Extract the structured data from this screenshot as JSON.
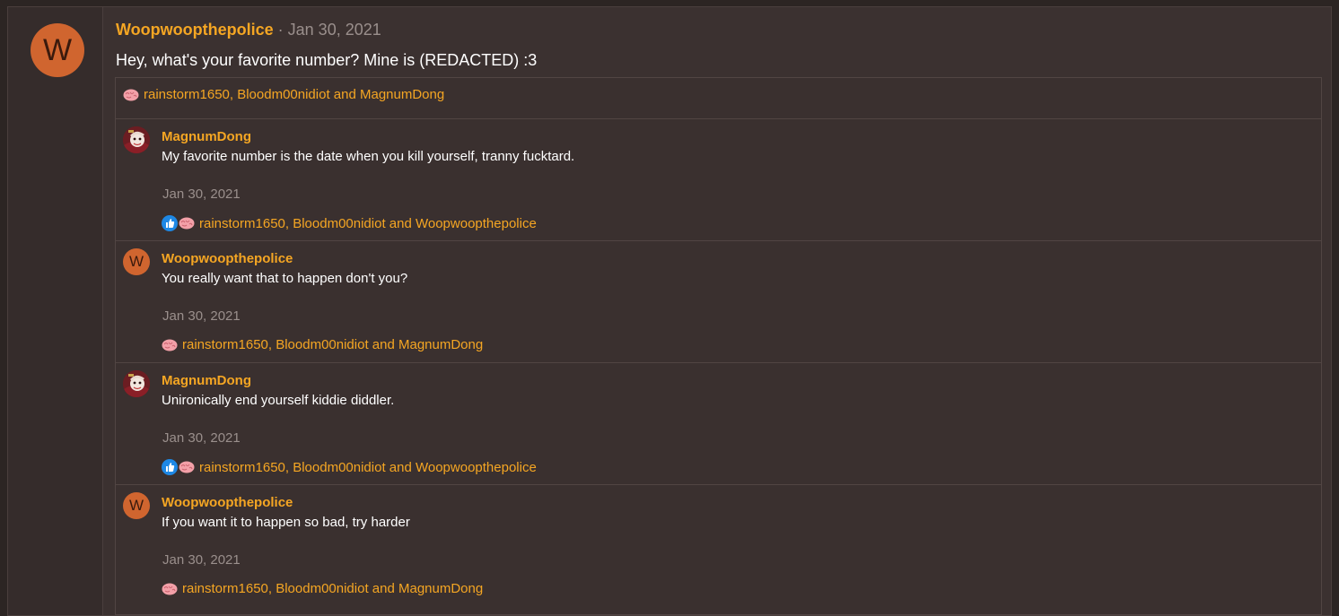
{
  "post": {
    "avatar_letter": "W",
    "author": "Woopwoopthepolice",
    "separator": " · ",
    "date": "Jan 30, 2021",
    "body": "Hey, what's your favorite number? Mine is (REDACTED) :3",
    "reactions": "rainstorm1650, Bloodm00nidiot and MagnumDong"
  },
  "replies": [
    {
      "author": "MagnumDong",
      "text": "My favorite number is the date when you kill yourself, tranny fucktard.",
      "date": "Jan 30, 2021",
      "reactions": "rainstorm1650, Bloodm00nidiot and Woopwoopthepolice"
    },
    {
      "author": "Woopwoopthepolice",
      "avatar_letter": "W",
      "text": "You really want that to happen don't you?",
      "date": "Jan 30, 2021",
      "reactions": "rainstorm1650, Bloodm00nidiot and MagnumDong"
    },
    {
      "author": "MagnumDong",
      "text": "Unironically end yourself kiddie diddler.",
      "date": "Jan 30, 2021",
      "reactions": "rainstorm1650, Bloodm00nidiot and Woopwoopthepolice"
    },
    {
      "author": "Woopwoopthepolice",
      "avatar_letter": "W",
      "text": "If you want it to happen so bad, try harder",
      "date": "Jan 30, 2021",
      "reactions": "rainstorm1650, Bloodm00nidiot and MagnumDong"
    }
  ],
  "icons": {
    "reaction_brain": "brain-icon",
    "reaction_like": "thumbs-up-icon"
  },
  "colors": {
    "accent": "#f5a623",
    "avatar": "#d0652f",
    "background": "#3b3130",
    "like": "#1e88e5"
  }
}
